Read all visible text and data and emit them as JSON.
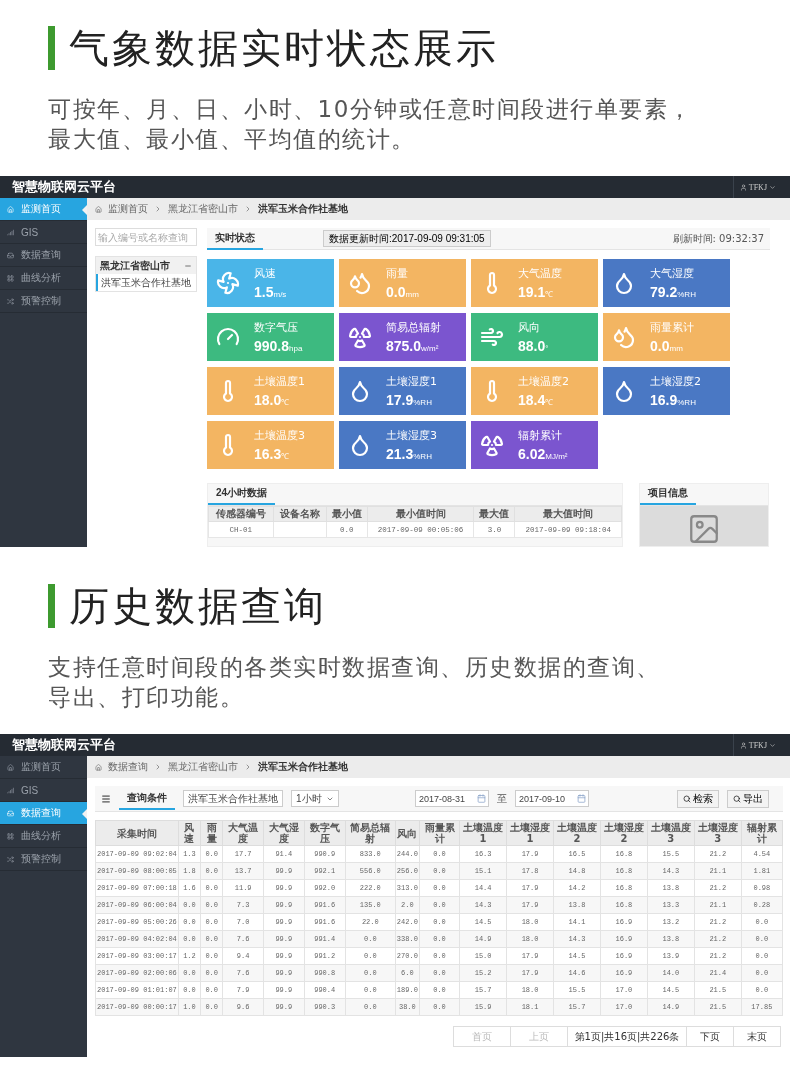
{
  "realtime": {
    "title": "气象数据实时状态展示",
    "description_lines": [
      "可按年、月、日、小时、10分钟或任意时间段进行单要素，",
      "最大值、最小值、平均值的统计。"
    ],
    "app": {
      "brand": "智慧物联网云平台",
      "user": "TFKJ",
      "sidebar": [
        {
          "label": "监测首页",
          "selected": true
        },
        {
          "label": "GIS",
          "selected": false
        },
        {
          "label": "数据查询",
          "selected": false
        },
        {
          "label": "曲线分析",
          "selected": false
        },
        {
          "label": "预警控制",
          "selected": false
        }
      ],
      "breadcrumb": [
        "监测首页",
        "黑龙江省密山市",
        "洪军玉米合作社基地"
      ],
      "search": {
        "placeholder": "输入编号或名称查询"
      },
      "tree": {
        "label": "黑龙江省密山市",
        "expanded": true,
        "children": [
          {
            "label": "洪军玉米合作社基地",
            "selected": true
          }
        ]
      },
      "tab": {
        "label": "实时状态",
        "selected": true
      },
      "update_time": "数据更新时间:2017-09-09 09:31:05",
      "refresh_time": "刷新时间: 09:32:37",
      "tiles": [
        {
          "kind": "fan",
          "label": "风速",
          "value": "1.5",
          "unit": "m/s",
          "color": "#4ab5e8"
        },
        {
          "kind": "rain",
          "label": "雨量",
          "value": "0.0",
          "unit": "mm",
          "color": "#f3b562"
        },
        {
          "kind": "temperature",
          "label": "大气温度",
          "value": "19.1",
          "unit": "℃",
          "color": "#f3b562"
        },
        {
          "kind": "humidity",
          "label": "大气湿度",
          "value": "79.2",
          "unit": "%RH",
          "color": "#4a78c4"
        },
        {
          "kind": "pressure",
          "label": "数字气压",
          "value": "990.8",
          "unit": "hpa",
          "color": "#3dba80"
        },
        {
          "kind": "radiation",
          "label": "简易总辐射",
          "value": "875.0",
          "unit": "w/m²",
          "color": "#7b55cf"
        },
        {
          "kind": "wind",
          "label": "风向",
          "value": "88.0",
          "unit": "°",
          "color": "#3dba80"
        },
        {
          "kind": "rain",
          "label": "雨量累计",
          "value": "0.0",
          "unit": "mm",
          "color": "#f3b562"
        },
        {
          "kind": "temperature",
          "label": "土壤温度1",
          "value": "18.0",
          "unit": "℃",
          "color": "#f3b562"
        },
        {
          "kind": "humidity",
          "label": "土壤湿度1",
          "value": "17.9",
          "unit": "%RH",
          "color": "#4a78c4"
        },
        {
          "kind": "temperature",
          "label": "土壤温度2",
          "value": "18.4",
          "unit": "℃",
          "color": "#f3b562"
        },
        {
          "kind": "humidity",
          "label": "土壤湿度2",
          "value": "16.9",
          "unit": "%RH",
          "color": "#4a78c4"
        },
        {
          "kind": "temperature",
          "label": "土壤温度3",
          "value": "16.3",
          "unit": "℃",
          "color": "#f3b562"
        },
        {
          "kind": "humidity",
          "label": "土壤湿度3",
          "value": "21.3",
          "unit": "%RH",
          "color": "#4a78c4"
        },
        {
          "kind": "radiation",
          "label": "辐射累计",
          "value": "6.02",
          "unit": "MJ/m²",
          "color": "#7b55cf"
        }
      ],
      "daily_panel": {
        "tab": {
          "label": "24小时数据",
          "selected": true
        },
        "columns": [
          "传感器编号",
          "设备名称",
          "最小值",
          "最小值时间",
          "最大值",
          "最大值时间"
        ],
        "rows": [
          [
            "CH-01",
            "",
            "0.0",
            "2017-09-09 00:05:06",
            "3.0",
            "2017-09-09 09:18:04"
          ]
        ]
      },
      "project_panel": {
        "tab": {
          "label": "项目信息",
          "selected": true
        }
      }
    }
  },
  "history": {
    "title": "历史数据查询",
    "description_lines": [
      "支持任意时间段的各类实时数据查询、历史数据的查询、",
      "导出、打印功能。"
    ],
    "app": {
      "brand": "智慧物联网云平台",
      "user": "TFKJ",
      "sidebar": [
        {
          "label": "监测首页",
          "selected": false
        },
        {
          "label": "GIS",
          "selected": false
        },
        {
          "label": "数据查询",
          "selected": true
        },
        {
          "label": "曲线分析",
          "selected": false
        },
        {
          "label": "预警控制",
          "selected": false
        }
      ],
      "breadcrumb": [
        "数据查询",
        "黑龙江省密山市",
        "洪军玉米合作社基地"
      ],
      "tab": {
        "label": "查询条件",
        "selected": true
      },
      "site_select": "洪军玉米合作社基地",
      "interval_select": "1小时",
      "date_from": "2017-08-31",
      "range_separator": "至",
      "date_to": "2017-09-10",
      "buttons": [
        "检索",
        "导出"
      ],
      "columns": [
        "采集时间",
        "风速",
        "雨量",
        "大气温度",
        "大气湿度",
        "数字气压",
        "简易总辐射",
        "风向",
        "雨量累计",
        "土壤温度1",
        "土壤湿度1",
        "土壤温度2",
        "土壤湿度2",
        "土壤温度3",
        "土壤湿度3",
        "辐射累计"
      ],
      "rows": [
        [
          "2017-09-09 09:02:04",
          "1.3",
          "0.0",
          "17.7",
          "91.4",
          "990.9",
          "833.0",
          "244.0",
          "0.0",
          "16.3",
          "17.9",
          "16.5",
          "16.8",
          "15.5",
          "21.2",
          "4.54"
        ],
        [
          "2017-09-09 08:00:05",
          "1.8",
          "0.0",
          "13.7",
          "99.9",
          "992.1",
          "556.0",
          "256.0",
          "0.0",
          "15.1",
          "17.8",
          "14.8",
          "16.8",
          "14.3",
          "21.1",
          "1.81"
        ],
        [
          "2017-09-09 07:00:18",
          "1.6",
          "0.0",
          "11.9",
          "99.9",
          "992.0",
          "222.0",
          "313.0",
          "0.0",
          "14.4",
          "17.9",
          "14.2",
          "16.8",
          "13.8",
          "21.2",
          "0.98"
        ],
        [
          "2017-09-09 06:00:04",
          "0.0",
          "0.0",
          "7.3",
          "99.9",
          "991.6",
          "135.0",
          "2.0",
          "0.0",
          "14.3",
          "17.9",
          "13.8",
          "16.8",
          "13.3",
          "21.1",
          "0.28"
        ],
        [
          "2017-09-09 05:00:26",
          "0.0",
          "0.0",
          "7.0",
          "99.9",
          "991.6",
          "22.0",
          "242.0",
          "0.0",
          "14.5",
          "18.0",
          "14.1",
          "16.9",
          "13.2",
          "21.2",
          "0.0"
        ],
        [
          "2017-09-09 04:02:04",
          "0.0",
          "0.0",
          "7.6",
          "99.9",
          "991.4",
          "0.0",
          "338.0",
          "0.0",
          "14.9",
          "18.0",
          "14.3",
          "16.9",
          "13.8",
          "21.2",
          "0.0"
        ],
        [
          "2017-09-09 03:00:17",
          "1.2",
          "0.0",
          "9.4",
          "99.9",
          "991.2",
          "0.0",
          "270.0",
          "0.0",
          "15.0",
          "17.9",
          "14.5",
          "16.9",
          "13.9",
          "21.2",
          "0.0"
        ],
        [
          "2017-09-09 02:00:06",
          "0.0",
          "0.0",
          "7.6",
          "99.9",
          "990.8",
          "0.0",
          "6.0",
          "0.0",
          "15.2",
          "17.9",
          "14.6",
          "16.9",
          "14.0",
          "21.4",
          "0.0"
        ],
        [
          "2017-09-09 01:01:07",
          "0.0",
          "0.0",
          "7.9",
          "99.9",
          "990.4",
          "0.0",
          "189.0",
          "0.0",
          "15.7",
          "18.0",
          "15.5",
          "17.0",
          "14.5",
          "21.5",
          "0.0"
        ],
        [
          "2017-09-09 00:00:17",
          "1.0",
          "0.0",
          "9.6",
          "99.9",
          "990.3",
          "0.0",
          "38.0",
          "0.0",
          "15.9",
          "18.1",
          "15.7",
          "17.0",
          "14.9",
          "21.5",
          "17.85"
        ]
      ],
      "pagination": {
        "before": [
          {
            "label": "首页",
            "disabled": true
          },
          {
            "label": "上页",
            "disabled": true
          }
        ],
        "info": "第1页|共16页|共226条",
        "after": [
          {
            "label": "下页",
            "disabled": false
          },
          {
            "label": "末页",
            "disabled": false
          }
        ]
      }
    }
  }
}
